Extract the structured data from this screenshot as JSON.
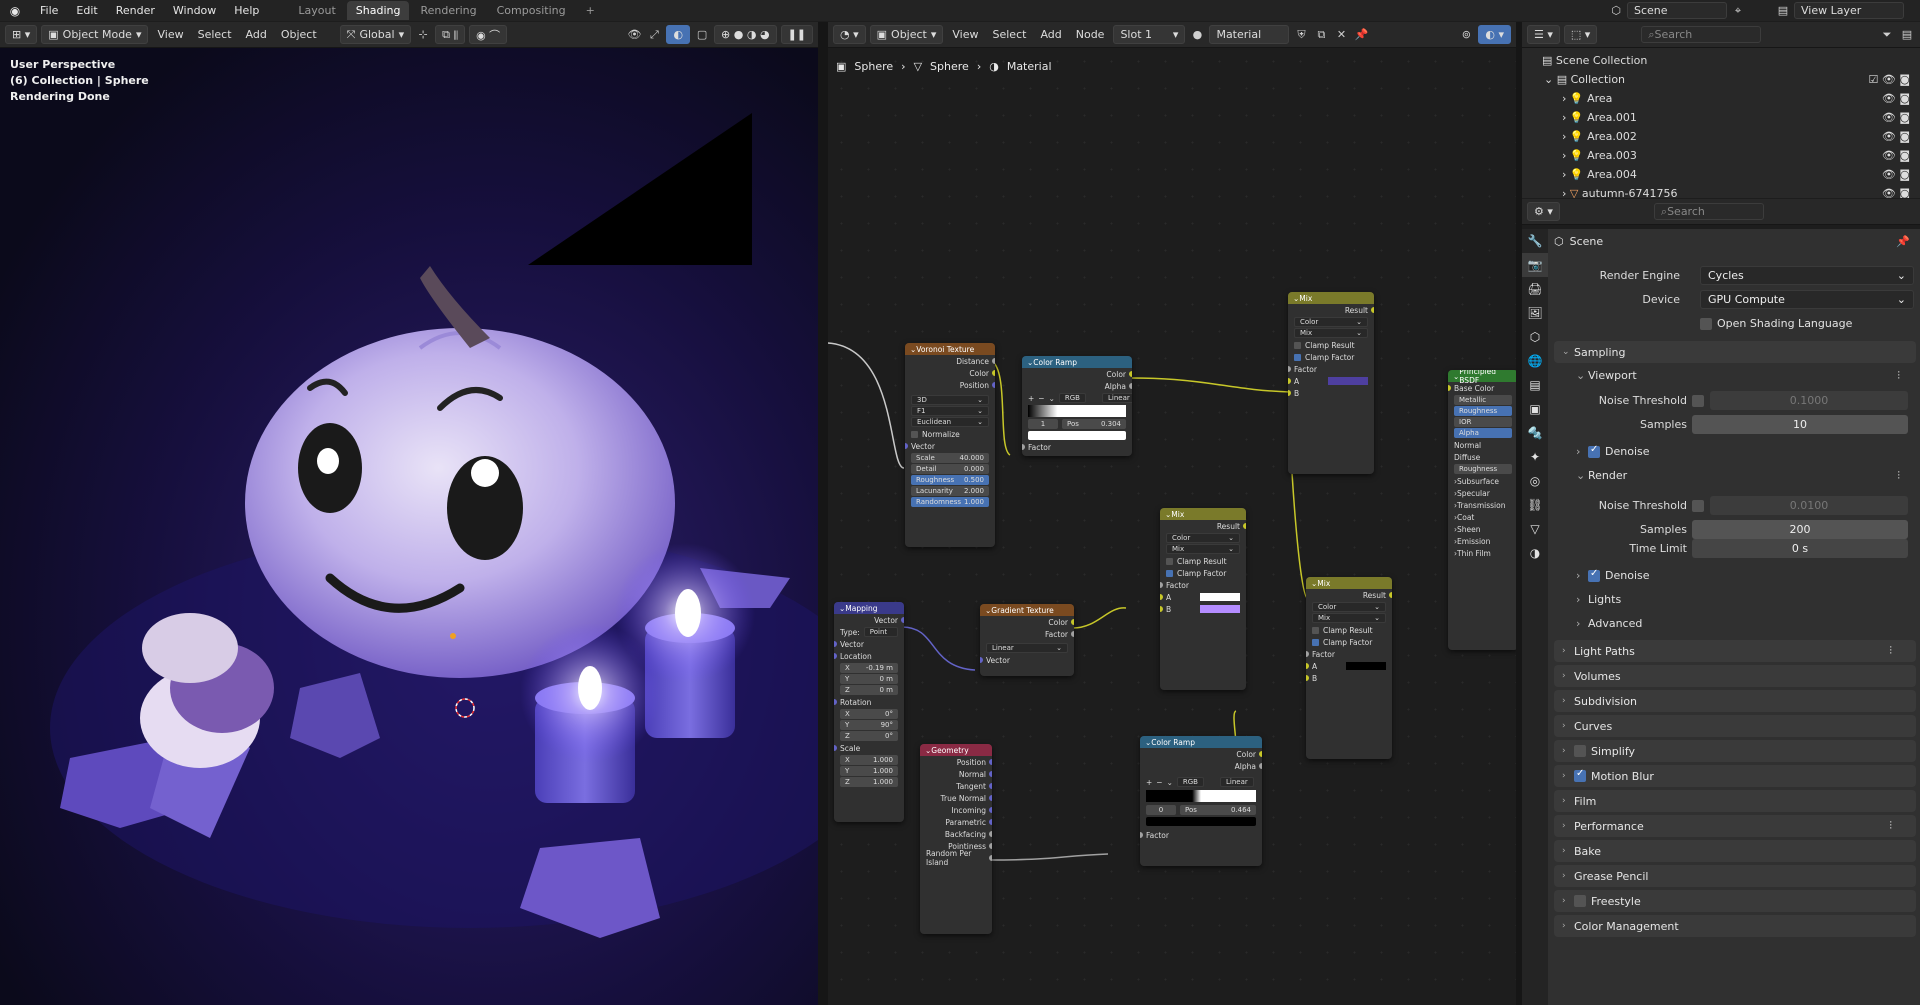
{
  "topbar": {
    "menus": [
      "File",
      "Edit",
      "Render",
      "Window",
      "Help"
    ],
    "workspaces": [
      {
        "label": "Layout"
      },
      {
        "label": "Shading",
        "active": true
      },
      {
        "label": "Rendering"
      },
      {
        "label": "Compositing"
      }
    ],
    "add_icon": "+",
    "scene": "Scene",
    "view_layer": "View Layer"
  },
  "viewport_header": {
    "mode": "Object Mode",
    "menus": [
      "View",
      "Select",
      "Add",
      "Object"
    ],
    "transform": "Global"
  },
  "viewport": {
    "perspective": "User Perspective",
    "collection": "(6) Collection | Sphere",
    "status": "Rendering Done"
  },
  "node_header": {
    "editor_type": "Object",
    "menus": [
      "View",
      "Select",
      "Add",
      "Node"
    ],
    "slot": "Slot 1",
    "material": "Material"
  },
  "breadcrumb": [
    "Sphere",
    "Sphere",
    "Material"
  ],
  "nodes": {
    "voronoi": {
      "title": "Voronoi Texture",
      "outputs": [
        "Distance",
        "Color",
        "Position"
      ],
      "dim": "3D",
      "feature": "F1",
      "metric": "Euclidean",
      "normalize": "Normalize",
      "vector": "Vector",
      "fields": [
        {
          "label": "Scale",
          "value": "40.000"
        },
        {
          "label": "Detail",
          "value": "0.000"
        },
        {
          "label": "Roughness",
          "value": "0.500"
        },
        {
          "label": "Lacunarity",
          "value": "2.000"
        },
        {
          "label": "Randomness",
          "value": "1.000"
        }
      ]
    },
    "ramp1": {
      "title": "Color Ramp",
      "outputs": [
        "Color",
        "Alpha"
      ],
      "mode": "RGB",
      "interp": "Linear",
      "index": "1",
      "pos_label": "Pos",
      "pos": "0.304",
      "factor": "Factor"
    },
    "mix1": {
      "title": "Mix",
      "result": "Result",
      "type": "Color",
      "blend": "Mix",
      "clamp_result": "Clamp Result",
      "clamp_factor": "Clamp Factor",
      "factor": "Factor",
      "a": "A",
      "b": "B"
    },
    "principled": {
      "title": "Principled BSDF",
      "base_color": "Base Color",
      "inputs": [
        "Metallic",
        "Roughness",
        "IOR",
        "Alpha"
      ],
      "normal": "Normal",
      "diffuse": "Diffuse",
      "roughness2": "Roughness",
      "sections": [
        "Subsurface",
        "Specular",
        "Transmission",
        "Coat",
        "Sheen",
        "Emission",
        "Thin Film"
      ]
    },
    "mix2": {
      "title": "Mix",
      "result": "Result",
      "type": "Color",
      "blend": "Mix",
      "clamp_result": "Clamp Result",
      "clamp_factor": "Clamp Factor",
      "factor": "Factor",
      "a": "A",
      "b": "B"
    },
    "mix3": {
      "title": "Mix",
      "result": "Result",
      "type": "Color",
      "blend": "Mix",
      "clamp_result": "Clamp Result",
      "clamp_factor": "Clamp Factor",
      "factor": "Factor",
      "a": "A",
      "b": "B"
    },
    "gradient": {
      "title": "Gradient Texture",
      "outputs": [
        "Color",
        "Factor"
      ],
      "type": "Linear",
      "vector": "Vector"
    },
    "mapping": {
      "title": "Mapping",
      "vector_out": "Vector",
      "type_label": "Type:",
      "type": "Point",
      "vector_in": "Vector",
      "location": "Location",
      "rotation": "Rotation",
      "scale": "Scale",
      "loc": [
        {
          "a": "X",
          "v": "-0.19 m"
        },
        {
          "a": "Y",
          "v": "0 m"
        },
        {
          "a": "Z",
          "v": "0 m"
        }
      ],
      "rot": [
        {
          "a": "X",
          "v": "0°"
        },
        {
          "a": "Y",
          "v": "90°"
        },
        {
          "a": "Z",
          "v": "0°"
        }
      ],
      "scl": [
        {
          "a": "X",
          "v": "1.000"
        },
        {
          "a": "Y",
          "v": "1.000"
        },
        {
          "a": "Z",
          "v": "1.000"
        }
      ]
    },
    "geometry": {
      "title": "Geometry",
      "outputs": [
        "Position",
        "Normal",
        "Tangent",
        "True Normal",
        "Incoming",
        "Parametric",
        "Backfacing",
        "Pointiness",
        "Random Per Island"
      ]
    },
    "ramp2": {
      "title": "Color Ramp",
      "outputs": [
        "Color",
        "Alpha"
      ],
      "mode": "RGB",
      "interp": "Linear",
      "index": "0",
      "pos_label": "Pos",
      "pos": "0.464",
      "factor": "Factor"
    }
  },
  "outliner": {
    "root": "Scene Collection",
    "collection": "Collection",
    "items": [
      "Area",
      "Area.001",
      "Area.002",
      "Area.003",
      "Area.004",
      "autumn-6741756"
    ]
  },
  "properties": {
    "search_placeholder": "Search",
    "context": "Scene",
    "render_engine_label": "Render Engine",
    "render_engine": "Cycles",
    "device_label": "Device",
    "device": "GPU Compute",
    "osl": "Open Shading Language",
    "sampling": "Sampling",
    "viewport": "Viewport",
    "noise_threshold_label": "Noise Threshold",
    "vp_noise_threshold": "0.1000",
    "samples_label": "Samples",
    "vp_samples": "10",
    "denoise": "Denoise",
    "render": "Render",
    "r_noise_threshold": "0.0100",
    "r_samples": "200",
    "time_limit_label": "Time Limit",
    "time_limit": "0 s",
    "lights": "Lights",
    "advanced": "Advanced",
    "panels": [
      "Light Paths",
      "Volumes",
      "Subdivision",
      "Curves",
      "Simplify",
      "Motion Blur",
      "Film",
      "Performance",
      "Bake",
      "Grease Pencil",
      "Freestyle",
      "Color Management"
    ]
  },
  "colors": {
    "accent": "#4772b3",
    "node_yellow": "#c7c729",
    "pumpkin": "#b9a6e6"
  }
}
